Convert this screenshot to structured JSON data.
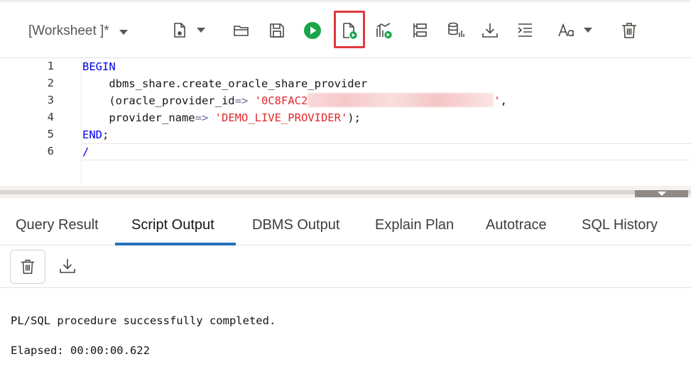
{
  "toolbar": {
    "worksheet_label": "[Worksheet ]*",
    "buttons": [
      {
        "name": "new-file-icon"
      },
      {
        "name": "open-folder-icon"
      },
      {
        "name": "save-icon"
      },
      {
        "name": "run-statement-icon"
      },
      {
        "name": "run-script-icon",
        "highlighted": true
      },
      {
        "name": "explain-plan-icon"
      },
      {
        "name": "autotrace-icon"
      },
      {
        "name": "database-icon"
      },
      {
        "name": "download-icon"
      },
      {
        "name": "format-icon"
      },
      {
        "name": "font-icon"
      },
      {
        "name": "trash-icon"
      }
    ],
    "highlight_color": "#e0393e",
    "run_color": "#1aa54a"
  },
  "editor": {
    "line_numbers": [
      "1",
      "2",
      "3",
      "4",
      "5",
      "6"
    ],
    "lines": {
      "l1": {
        "kw": "BEGIN"
      },
      "l2": {
        "text": "    dbms_share.create_oracle_share_provider"
      },
      "l3": {
        "pre": "    (oracle_provider_id",
        "op": "=>",
        "space": " ",
        "str_start": "'0C8FAC2",
        "str_end": "'",
        "tail": ","
      },
      "l4": {
        "pre": "    provider_name",
        "op": "=>",
        "space": " ",
        "str": "'DEMO_LIVE_PROVIDER'",
        "tail": ");"
      },
      "l5": {
        "kw": "END",
        "tail": ";"
      },
      "l6": {
        "kw": "/"
      }
    },
    "keyword_color": "#0000e8",
    "string_color": "#e0282a"
  },
  "tabs": [
    {
      "label": "Query Result"
    },
    {
      "label": "Script Output",
      "active": true
    },
    {
      "label": "DBMS Output"
    },
    {
      "label": "Explain Plan"
    },
    {
      "label": "Autotrace"
    },
    {
      "label": "SQL History"
    }
  ],
  "output": {
    "lines": [
      "PL/SQL procedure successfully completed.",
      "Elapsed: 00:00:00.622"
    ]
  }
}
